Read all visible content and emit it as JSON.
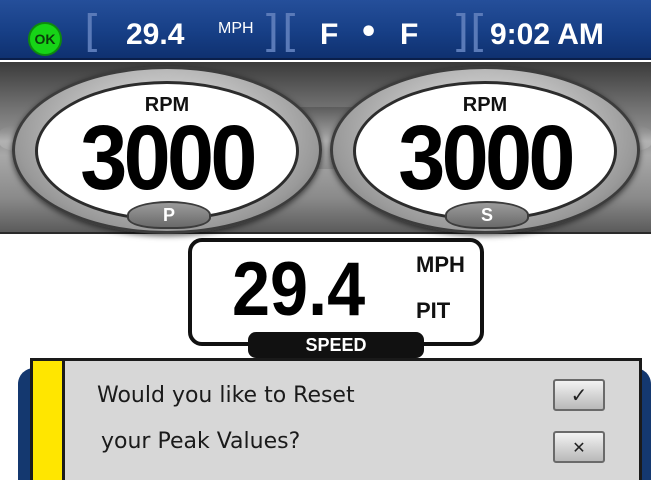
{
  "status_bar": {
    "ok_badge": "OK",
    "speed_value": "29.4",
    "speed_unit": "MPH",
    "tank_left": "F",
    "tank_separator": "•",
    "tank_right": "F",
    "clock": "9:02 AM"
  },
  "gauges": [
    {
      "label": "RPM",
      "value": "3000",
      "tag": "P"
    },
    {
      "label": "RPM",
      "value": "3000",
      "tag": "S"
    }
  ],
  "speed_panel": {
    "value": "29.4",
    "unit": "MPH",
    "sub_label": "PIT",
    "caption": "SPEED"
  },
  "dialog": {
    "line1": "Would you like to Reset",
    "line2": "your Peak Values?",
    "confirm_icon": "✓",
    "cancel_icon": "✕"
  },
  "colors": {
    "status_bar_blue": "#173f86",
    "ok_green": "#17d417",
    "dialog_stripe_yellow": "#ffe600",
    "dialog_background": "#d7d7d7"
  }
}
